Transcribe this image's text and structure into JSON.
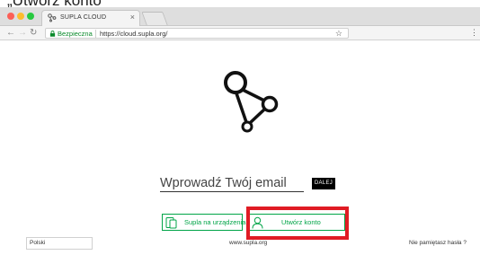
{
  "caption": "„Utwórz konto",
  "browser": {
    "tab_title": "SUPLA CLOUD",
    "tab_close": "×",
    "secure_label": "Bezpieczna",
    "url": "https://cloud.supla.org/",
    "star_glyph": "☆",
    "menu_glyph": "⋮"
  },
  "form": {
    "email_placeholder": "Wprowadź Twój email",
    "next_label": "DALEJ"
  },
  "actions": {
    "devices_label": "Supla na urządzenia",
    "create_label": "Utwórz konto"
  },
  "footer": {
    "language": "Polski",
    "site_link": "www.supla.org",
    "forgot_label": "Nie pamiętasz hasła ?"
  },
  "colors": {
    "brand_green": "#00a447",
    "highlight_red": "#e01b24",
    "secure_green": "#0a8a2b"
  },
  "icons": {
    "logo": "supla-logo-icon",
    "lock": "lock-icon",
    "devices": "devices-icon",
    "user": "user-icon"
  }
}
